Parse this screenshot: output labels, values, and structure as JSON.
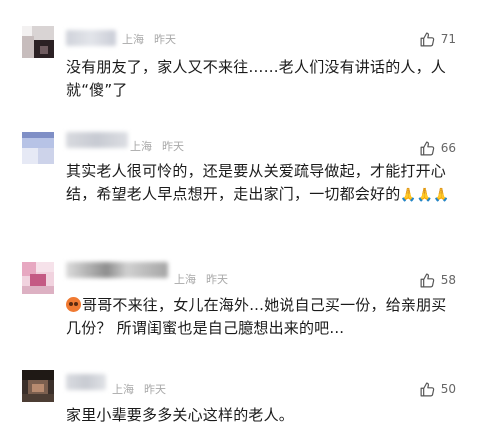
{
  "comments": [
    {
      "location": "上海",
      "time": "昨天",
      "likes": "71",
      "text": "没有朋友了，家人又不来往……老人们没有讲话的人，人就“傻”了",
      "emojis": ""
    },
    {
      "location": "上海",
      "time": "昨天",
      "likes": "66",
      "text": "其实老人很可怜的，还是要从关爱疏导做起，才能打开心结，希望老人早点想开，走出家门，一切都会好的",
      "emojis": "🙏🙏🙏"
    },
    {
      "location": "上海",
      "time": "昨天",
      "likes": "58",
      "text": "哥哥不来往，女儿在海外...她说自己买一份，给亲朋买几份？ 所谓闺蜜也是自己臆想出来的吧...",
      "emojis": ""
    },
    {
      "location": "上海",
      "time": "昨天",
      "likes": "50",
      "text": "家里小辈要多多关心这样的老人。",
      "emojis": ""
    }
  ],
  "icons": {
    "like": "thumbs-up-icon"
  }
}
